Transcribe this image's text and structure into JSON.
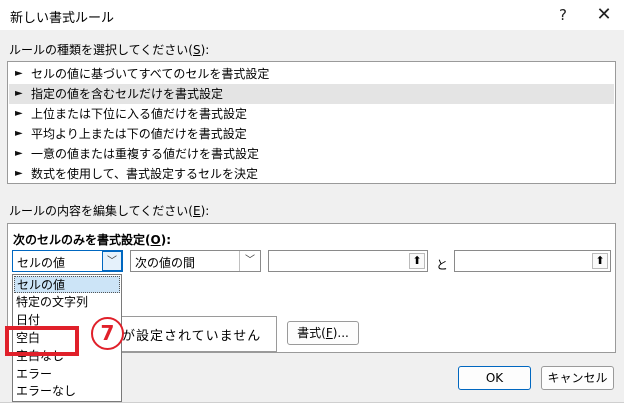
{
  "window": {
    "title": "新しい書式ルール",
    "help_glyph": "?",
    "close_glyph": "✕"
  },
  "rule_type": {
    "label_prefix": "ルールの種類を選択してください(",
    "label_accel": "S",
    "label_suffix": "):",
    "items": [
      "セルの値に基づいてすべてのセルを書式設定",
      "指定の値を含むセルだけを書式設定",
      "上位または下位に入る値だけを書式設定",
      "平均より上または下の値だけを書式設定",
      "一意の値または重複する値だけを書式設定",
      "数式を使用して、書式設定するセルを決定"
    ],
    "selected_index": 1,
    "bullet_glyph": "►"
  },
  "rule_edit": {
    "label_prefix": "ルールの内容を編集してください(",
    "label_accel": "E",
    "label_suffix": "):",
    "heading_prefix": "次のセルのみを書式設定(",
    "heading_accel": "O",
    "heading_suffix": "):",
    "condition_combo": "セルの値",
    "operator_combo": "次の値の間",
    "value1": "",
    "value2": "",
    "and_label": "と",
    "combo_arrow": "﹀",
    "ref_button_glyph": "⬆"
  },
  "dropdown": {
    "options": [
      "セルの値",
      "特定の文字列",
      "日付",
      "空白",
      "空白なし",
      "エラー",
      "エラーなし"
    ],
    "selected_index": 0
  },
  "preview": {
    "text": "が設定されていません"
  },
  "format_button": {
    "prefix": "書式(",
    "accel": "F",
    "suffix": ")..."
  },
  "buttons": {
    "ok": "OK",
    "cancel": "キャンセル"
  },
  "annotation": {
    "step_number": "7",
    "accent_color": "#e0202a"
  }
}
